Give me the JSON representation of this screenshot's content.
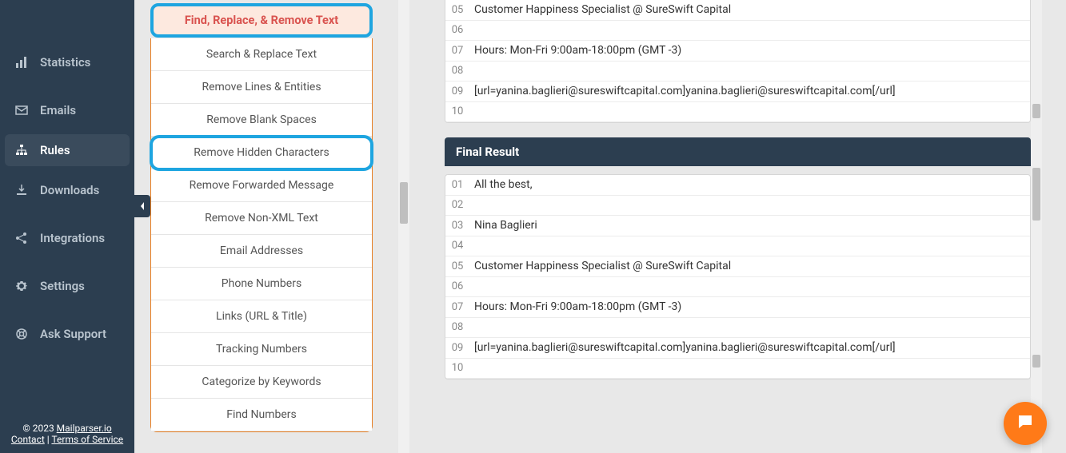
{
  "sidebar": {
    "items": [
      {
        "icon": "bar-chart-icon",
        "label": "Statistics"
      },
      {
        "icon": "mail-icon",
        "label": "Emails"
      },
      {
        "icon": "sitemap-icon",
        "label": "Rules",
        "active": true
      },
      {
        "icon": "download-icon",
        "label": "Downloads"
      },
      {
        "icon": "share-icon",
        "label": "Integrations"
      },
      {
        "icon": "gear-icon",
        "label": "Settings"
      },
      {
        "icon": "life-ring-icon",
        "label": "Ask Support"
      }
    ],
    "footer": {
      "copyright_prefix": "© 2023 ",
      "brand": "Mailparser.io",
      "contact": "Contact",
      "separator": " | ",
      "tos": "Terms of Service"
    }
  },
  "rules": {
    "header": "Find, Replace, & Remove Text",
    "options": [
      "Search & Replace Text",
      "Remove Lines & Entities",
      "Remove Blank Spaces",
      "Remove Hidden Characters",
      "Remove Forwarded Message",
      "Remove Non-XML Text",
      "Email Addresses",
      "Phone Numbers",
      "Links (URL & Title)",
      "Tracking Numbers",
      "Categorize by Keywords",
      "Find Numbers"
    ],
    "highlighted_index": 3
  },
  "top_result": {
    "start_num": 5,
    "lines": [
      "Customer Happiness Specialist @ SureSwift Capital",
      "",
      "Hours: Mon-Fri 9:00am-18:00pm (GMT -3)",
      "",
      "[url=yanina.baglieri@sureswiftcapital.com]yanina.baglieri@sureswiftcapital.com[/url]",
      ""
    ]
  },
  "final_result": {
    "header": "Final Result",
    "start_num": 1,
    "lines": [
      "All the best,",
      "",
      "Nina Baglieri",
      "",
      "Customer Happiness Specialist @ SureSwift Capital",
      "",
      "Hours: Mon-Fri 9:00am-18:00pm (GMT -3)",
      "",
      "[url=yanina.baglieri@sureswiftcapital.com]yanina.baglieri@sureswiftcapital.com[/url]",
      ""
    ]
  }
}
